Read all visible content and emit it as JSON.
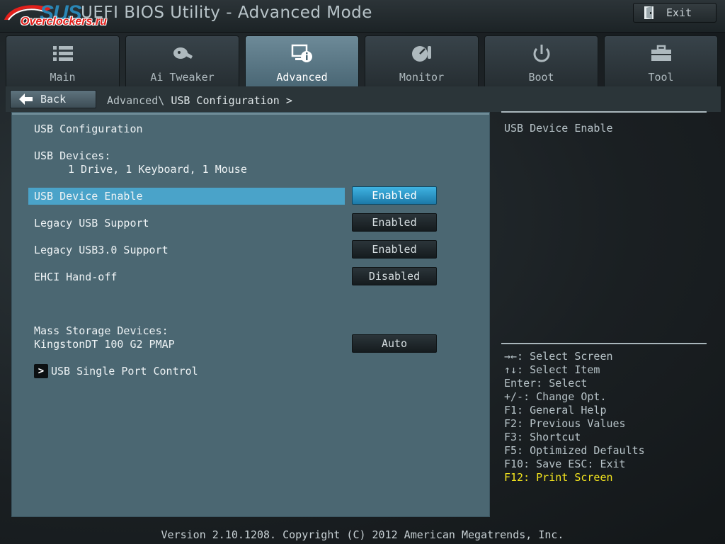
{
  "branding": {
    "logo_partial": "SUS",
    "watermark": "Overclockers.ru",
    "app_title": "UEFI BIOS Utility - Advanced Mode",
    "exit_label": "Exit"
  },
  "tabs": [
    {
      "label": "Main",
      "icon": "list-icon",
      "active": false
    },
    {
      "label": "Ai Tweaker",
      "icon": "tweaker-icon",
      "active": false
    },
    {
      "label": "Advanced",
      "icon": "advanced-icon",
      "active": true
    },
    {
      "label": "Monitor",
      "icon": "monitor-gauge-icon",
      "active": false
    },
    {
      "label": "Boot",
      "icon": "power-icon",
      "active": false
    },
    {
      "label": "Tool",
      "icon": "toolbox-icon",
      "active": false
    }
  ],
  "nav": {
    "back_label": "Back",
    "breadcrumb_root": "Advanced\\",
    "breadcrumb_current": "USB Configuration >"
  },
  "main": {
    "section_title": "USB Configuration",
    "usb_devices_label": "USB Devices:",
    "usb_devices_value": "1 Drive, 1 Keyboard, 1 Mouse",
    "settings": [
      {
        "label": "USB Device Enable",
        "value": "Enabled",
        "selected": true
      },
      {
        "label": "Legacy USB Support",
        "value": "Enabled",
        "selected": false
      },
      {
        "label": "Legacy USB3.0 Support",
        "value": "Enabled",
        "selected": false
      },
      {
        "label": "EHCI Hand-off",
        "value": "Disabled",
        "selected": false
      }
    ],
    "mass_storage_label": "Mass Storage Devices:",
    "mass_storage_device": "KingstonDT 100 G2 PMAP",
    "mass_storage_value": "Auto",
    "submenu_arrow": ">",
    "submenu_label": "USB Single Port Control"
  },
  "help": {
    "description": "USB Device Enable",
    "keys": [
      "→←: Select Screen",
      "↑↓: Select Item",
      "Enter: Select",
      "+/-: Change Opt.",
      "F1: General Help",
      "F2: Previous Values",
      "F3: Shortcut",
      "F5: Optimized Defaults",
      "F10: Save  ESC: Exit",
      "F12: Print Screen"
    ]
  },
  "footer": {
    "version": "Version 2.10.1208. Copyright (C) 2012 American Megatrends, Inc."
  },
  "colors": {
    "accent": "#4aa3c9",
    "panel": "#4b6772",
    "highlight_key": "#f4e51e"
  }
}
